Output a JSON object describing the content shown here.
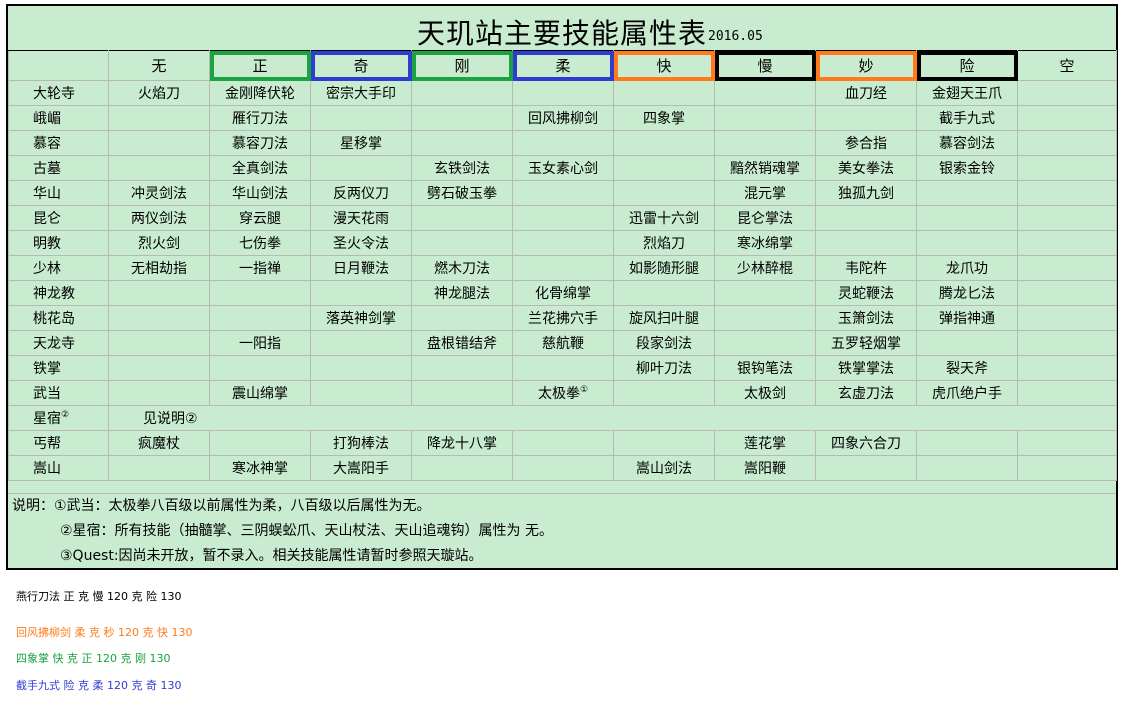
{
  "title": "天玑站主要技能属性表",
  "date": "2016.05",
  "attributes": [
    "无",
    "正",
    "奇",
    "刚",
    "柔",
    "快",
    "慢",
    "妙",
    "险",
    "空"
  ],
  "rows": [
    {
      "sect": "大轮寺",
      "cells": [
        "火焰刀",
        "金刚降伏轮",
        "密宗大手印",
        "",
        "",
        "",
        "",
        "血刀经",
        "金翅天王爪",
        ""
      ]
    },
    {
      "sect": "峨嵋",
      "cells": [
        "",
        "雁行刀法",
        "",
        "",
        "回风拂柳剑",
        "四象掌",
        "",
        "",
        "截手九式",
        ""
      ]
    },
    {
      "sect": "慕容",
      "cells": [
        "",
        "慕容刀法",
        "星移掌",
        "",
        "",
        "",
        "",
        "参合指",
        "慕容剑法",
        ""
      ]
    },
    {
      "sect": "古墓",
      "cells": [
        "",
        "全真剑法",
        "",
        "玄铁剑法",
        "玉女素心剑",
        "",
        "黯然销魂掌",
        "美女拳法",
        "银索金铃",
        ""
      ]
    },
    {
      "sect": "华山",
      "cells": [
        "冲灵剑法",
        "华山剑法",
        "反两仪刀",
        "劈石破玉拳",
        "",
        "",
        "混元掌",
        "独孤九剑",
        "",
        ""
      ]
    },
    {
      "sect": "昆仑",
      "cells": [
        "两仪剑法",
        "穿云腿",
        "漫天花雨",
        "",
        "",
        "迅雷十六剑",
        "昆仑掌法",
        "",
        "",
        ""
      ]
    },
    {
      "sect": "明教",
      "cells": [
        "烈火剑",
        "七伤拳",
        "圣火令法",
        "",
        "",
        "烈焰刀",
        "寒冰绵掌",
        "",
        "",
        ""
      ]
    },
    {
      "sect": "少林",
      "cells": [
        "无相劫指",
        "一指禅",
        "日月鞭法",
        "燃木刀法",
        "",
        "如影随形腿",
        "少林醉棍",
        "韦陀杵",
        "龙爪功",
        ""
      ]
    },
    {
      "sect": "神龙教",
      "cells": [
        "",
        "",
        "",
        "神龙腿法",
        "化骨绵掌",
        "",
        "",
        "灵蛇鞭法",
        "腾龙匕法",
        ""
      ]
    },
    {
      "sect": "桃花岛",
      "cells": [
        "",
        "",
        "落英神剑掌",
        "",
        "兰花拂穴手",
        "旋风扫叶腿",
        "",
        "玉箫剑法",
        "弹指神通",
        ""
      ]
    },
    {
      "sect": "天龙寺",
      "cells": [
        "",
        "一阳指",
        "",
        "盘根错结斧",
        "慈航鞭",
        "段家剑法",
        "",
        "五罗轻烟掌",
        "",
        ""
      ]
    },
    {
      "sect": "铁掌",
      "cells": [
        "",
        "",
        "",
        "",
        "",
        "柳叶刀法",
        "银钩笔法",
        "铁掌掌法",
        "裂天斧",
        ""
      ]
    },
    {
      "sect": "武当",
      "cells": [
        "",
        "震山绵掌",
        "",
        "",
        "太极拳",
        "",
        "太极剑",
        "玄虚刀法",
        "虎爪绝户手",
        ""
      ],
      "mark_cell": 4,
      "mark": "①"
    },
    {
      "sect": "星宿",
      "sect_mark": "②",
      "note": "见说明②"
    },
    {
      "sect": "丐帮",
      "cells": [
        "疯魔杖",
        "",
        "打狗棒法",
        "降龙十八掌",
        "",
        "",
        "莲花掌",
        "四象六合刀",
        "",
        ""
      ]
    },
    {
      "sect": "嵩山",
      "cells": [
        "",
        "寒冰神掌",
        "大嵩阳手",
        "",
        "",
        "嵩山剑法",
        "嵩阳鞭",
        "",
        "",
        ""
      ]
    }
  ],
  "notes": [
    "说明：①武当：太极拳八百级以前属性为柔，八百级以后属性为无。",
    "②星宿：所有技能（抽髓掌、三阴蜈蚣爪、天山杖法、天山追魂钩）属性为 无。",
    "③Quest:因尚未开放，暂不录入。相关技能属性请暂时参照天璇站。"
  ],
  "highlight_colors": {
    "green": "#1aa340",
    "blue": "#2f3cd0",
    "orange": "#ff7a1a",
    "black": "#000000"
  },
  "attribute_highlights": [
    "",
    "green",
    "blue",
    "green",
    "blue",
    "orange",
    "black",
    "orange",
    "black",
    ""
  ],
  "calculations": [
    {
      "text": "燕行刀法 正 克 慢 120 克 险 130",
      "color": "#000000"
    },
    {
      "text": "回风拂柳剑 柔 克 秒 120 克 快 130",
      "color": "#ff7a1a"
    },
    {
      "text": "四象掌 快 克 正 120 克 刚 130",
      "color": "#1aa340"
    },
    {
      "text": "截手九式 险 克 柔 120 克 奇 130",
      "color": "#2f3cd0"
    }
  ]
}
